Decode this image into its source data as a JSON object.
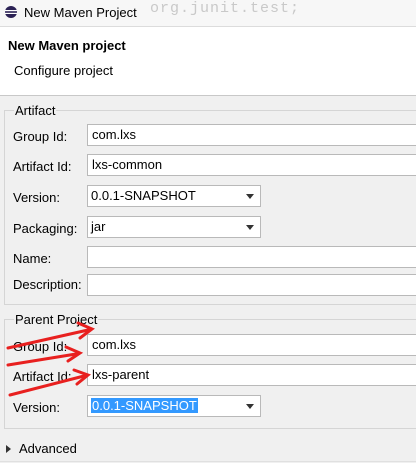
{
  "window": {
    "title": "New Maven Project",
    "background_text": "org.junit.test;",
    "icon": "eclipse-icon"
  },
  "header": {
    "title": "New Maven project",
    "subtitle": "Configure project"
  },
  "artifact": {
    "group_label": "Artifact",
    "group_id_label": "Group Id:",
    "group_id_value": "com.lxs",
    "artifact_id_label": "Artifact Id:",
    "artifact_id_value": "lxs-common",
    "version_label": "Version:",
    "version_value": "0.0.1-SNAPSHOT",
    "packaging_label": "Packaging:",
    "packaging_value": "jar",
    "name_label": "Name:",
    "name_value": "",
    "description_label": "Description:",
    "description_value": ""
  },
  "parent": {
    "group_label": "Parent Project",
    "group_id_label": "Group Id:",
    "group_id_value": "com.lxs",
    "artifact_id_label": "Artifact Id:",
    "artifact_id_value": "lxs-parent",
    "version_label": "Version:",
    "version_value": "0.0.1-SNAPSHOT"
  },
  "advanced": {
    "label": "Advanced"
  },
  "colors": {
    "selection": "#3399ff",
    "arrow": "#e8201f"
  }
}
